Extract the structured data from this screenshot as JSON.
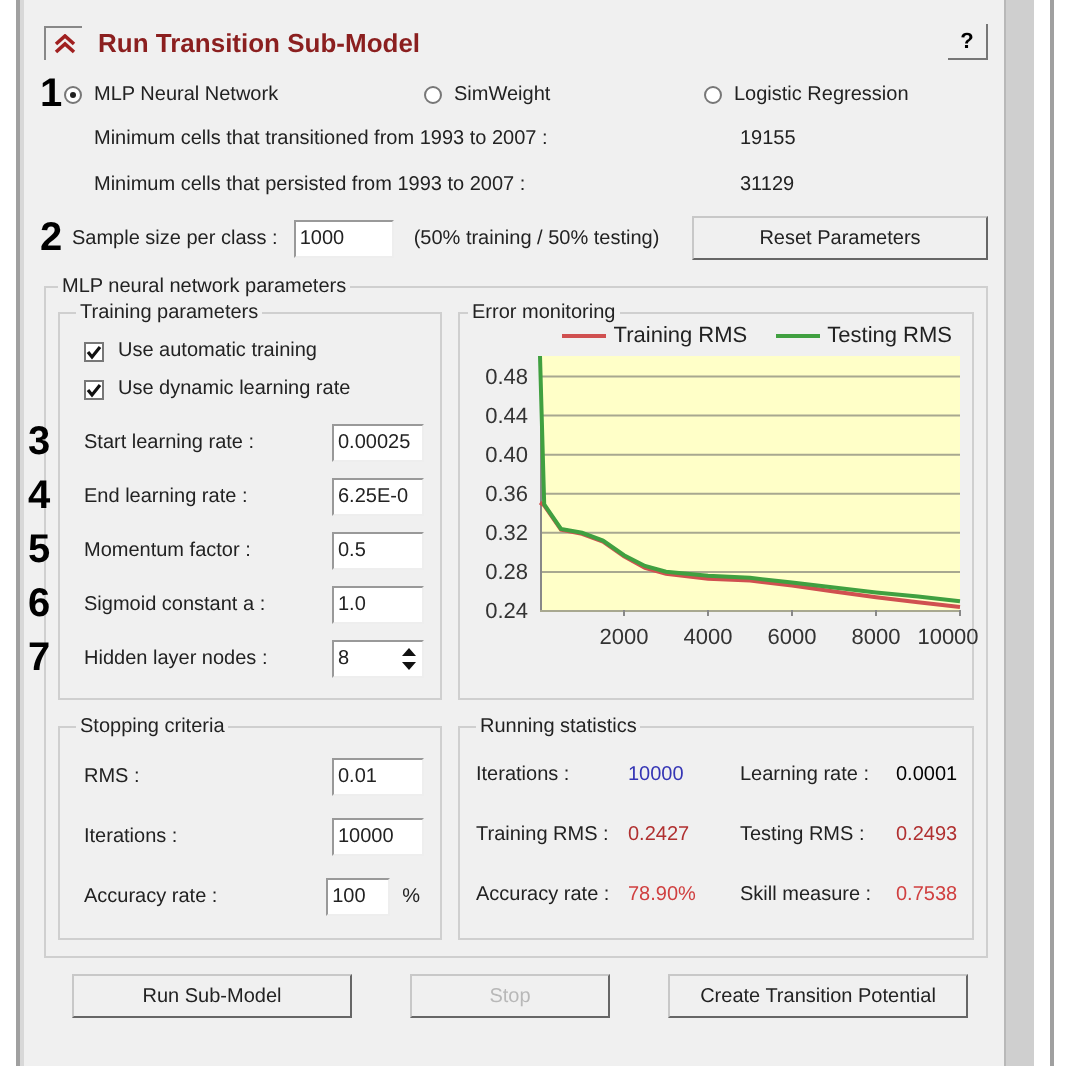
{
  "title": "Run Transition Sub-Model",
  "help_button": "?",
  "models": [
    {
      "label": "MLP Neural Network",
      "selected": true,
      "marker": "1"
    },
    {
      "label": "SimWeight",
      "selected": false
    },
    {
      "label": "Logistic Regression",
      "selected": false
    }
  ],
  "cell_counts": [
    {
      "label": "Minimum cells that transitioned from 1993 to 2007 :",
      "value": "19155"
    },
    {
      "label": "Minimum cells that persisted from 1993 to 2007 :",
      "value": "31129"
    }
  ],
  "sample_size": {
    "marker": "2",
    "label": "Sample size per class :",
    "value": "1000",
    "note": "(50% training / 50% testing)"
  },
  "reset_button": "Reset Parameters",
  "mlp_parameters": {
    "title": "MLP neural network parameters",
    "training_parameters": {
      "title": "Training parameters",
      "options": [
        {
          "label": "Use automatic training",
          "checked": true
        },
        {
          "label": "Use dynamic learning rate",
          "checked": true
        }
      ],
      "fields": [
        {
          "marker": "3",
          "label": "Start learning rate :",
          "value": "0.00025",
          "kind": "text"
        },
        {
          "marker": "4",
          "label": "End learning rate :",
          "value": "6.25E-0",
          "kind": "text"
        },
        {
          "marker": "5",
          "label": "Momentum factor :",
          "value": "0.5",
          "kind": "text"
        },
        {
          "marker": "6",
          "label": "Sigmoid constant a :",
          "value": "1.0",
          "kind": "text"
        },
        {
          "marker": "7",
          "label": "Hidden layer nodes :",
          "value": "8",
          "kind": "spin"
        }
      ]
    },
    "error_monitoring": {
      "title": "Error monitoring",
      "chart_data": {
        "type": "line",
        "x": [
          0,
          100,
          500,
          1000,
          1500,
          2000,
          2500,
          3000,
          4000,
          5000,
          6000,
          7000,
          8000,
          9000,
          10000
        ],
        "series": [
          {
            "name": "Training RMS",
            "color": "#d05050",
            "values": [
              0.35,
              0.347,
              0.322,
              0.318,
              0.31,
              0.295,
              0.283,
              0.277,
              0.272,
              0.27,
              0.265,
              0.259,
              0.253,
              0.248,
              0.243
            ]
          },
          {
            "name": "Testing RMS",
            "color": "#40a040",
            "values": [
              0.5,
              0.348,
              0.323,
              0.319,
              0.311,
              0.296,
              0.285,
              0.279,
              0.275,
              0.273,
              0.268,
              0.263,
              0.258,
              0.254,
              0.249
            ]
          }
        ],
        "grid": true,
        "xlim": [
          0,
          10000
        ],
        "ylim": [
          0.24,
          0.5
        ],
        "xticks": [
          2000,
          4000,
          6000,
          8000,
          10000
        ],
        "yticks": [
          {
            "value": 0.24,
            "label": "0.24"
          },
          {
            "value": 0.28,
            "label": "0.28"
          },
          {
            "value": 0.32,
            "label": "0.32"
          },
          {
            "value": 0.36,
            "label": "0.36"
          },
          {
            "value": 0.4,
            "label": "0.40"
          },
          {
            "value": 0.44,
            "label": "0.44"
          },
          {
            "value": 0.48,
            "label": "0.48"
          }
        ]
      }
    },
    "stopping_criteria": {
      "title": "Stopping criteria",
      "fields": [
        {
          "label": "RMS :",
          "value": "0.01"
        },
        {
          "label": "Iterations :",
          "value": "10000"
        },
        {
          "label": "Accuracy rate :",
          "value": "100",
          "unit": "%"
        }
      ]
    },
    "running_statistics": {
      "title": "Running statistics",
      "stats": [
        {
          "label": "Iterations :",
          "value": "10000",
          "color": "#3535b5"
        },
        {
          "label": "Learning rate :",
          "value": "0.0001",
          "color": "#000000"
        },
        {
          "label": "Training RMS :",
          "value": "0.2427",
          "color": "#b03030"
        },
        {
          "label": "Testing RMS :",
          "value": "0.2493",
          "color": "#b03030"
        },
        {
          "label": "Accuracy rate :",
          "value": "78.90%",
          "color": "#d04040"
        },
        {
          "label": "Skill measure :",
          "value": "0.7538",
          "color": "#d04040"
        }
      ]
    }
  },
  "buttons": [
    {
      "label": "Run Sub-Model",
      "disabled": false
    },
    {
      "label": "Stop",
      "disabled": true
    },
    {
      "label": "Create Transition Potential",
      "disabled": false
    }
  ]
}
